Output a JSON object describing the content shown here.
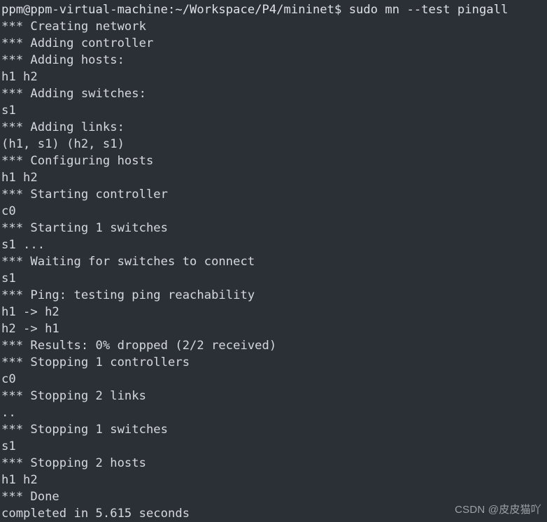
{
  "terminal": {
    "background_color": "#2a3036",
    "text_color": "#d5d9dd",
    "prompt": {
      "user": "ppm",
      "host": "ppm-virtual-machine",
      "cwd": "~/Workspace/P4/mininet",
      "symbol": "$",
      "command": "sudo mn --test pingall",
      "full_line": "ppm@ppm-virtual-machine:~/Workspace/P4/mininet$ sudo mn --test pingall"
    },
    "lines": [
      "ppm@ppm-virtual-machine:~/Workspace/P4/mininet$ sudo mn --test pingall",
      "*** Creating network",
      "*** Adding controller",
      "*** Adding hosts:",
      "h1 h2",
      "*** Adding switches:",
      "s1",
      "*** Adding links:",
      "(h1, s1) (h2, s1)",
      "*** Configuring hosts",
      "h1 h2",
      "*** Starting controller",
      "c0",
      "*** Starting 1 switches",
      "s1 ...",
      "*** Waiting for switches to connect",
      "s1",
      "*** Ping: testing ping reachability",
      "h1 -> h2",
      "h2 -> h1",
      "*** Results: 0% dropped (2/2 received)",
      "*** Stopping 1 controllers",
      "c0",
      "*** Stopping 2 links",
      "..",
      "*** Stopping 1 switches",
      "s1",
      "*** Stopping 2 hosts",
      "h1 h2",
      "*** Done",
      "completed in 5.615 seconds"
    ]
  },
  "watermark": {
    "text": "CSDN @皮皮猫吖",
    "color": "#9ba1a7"
  }
}
